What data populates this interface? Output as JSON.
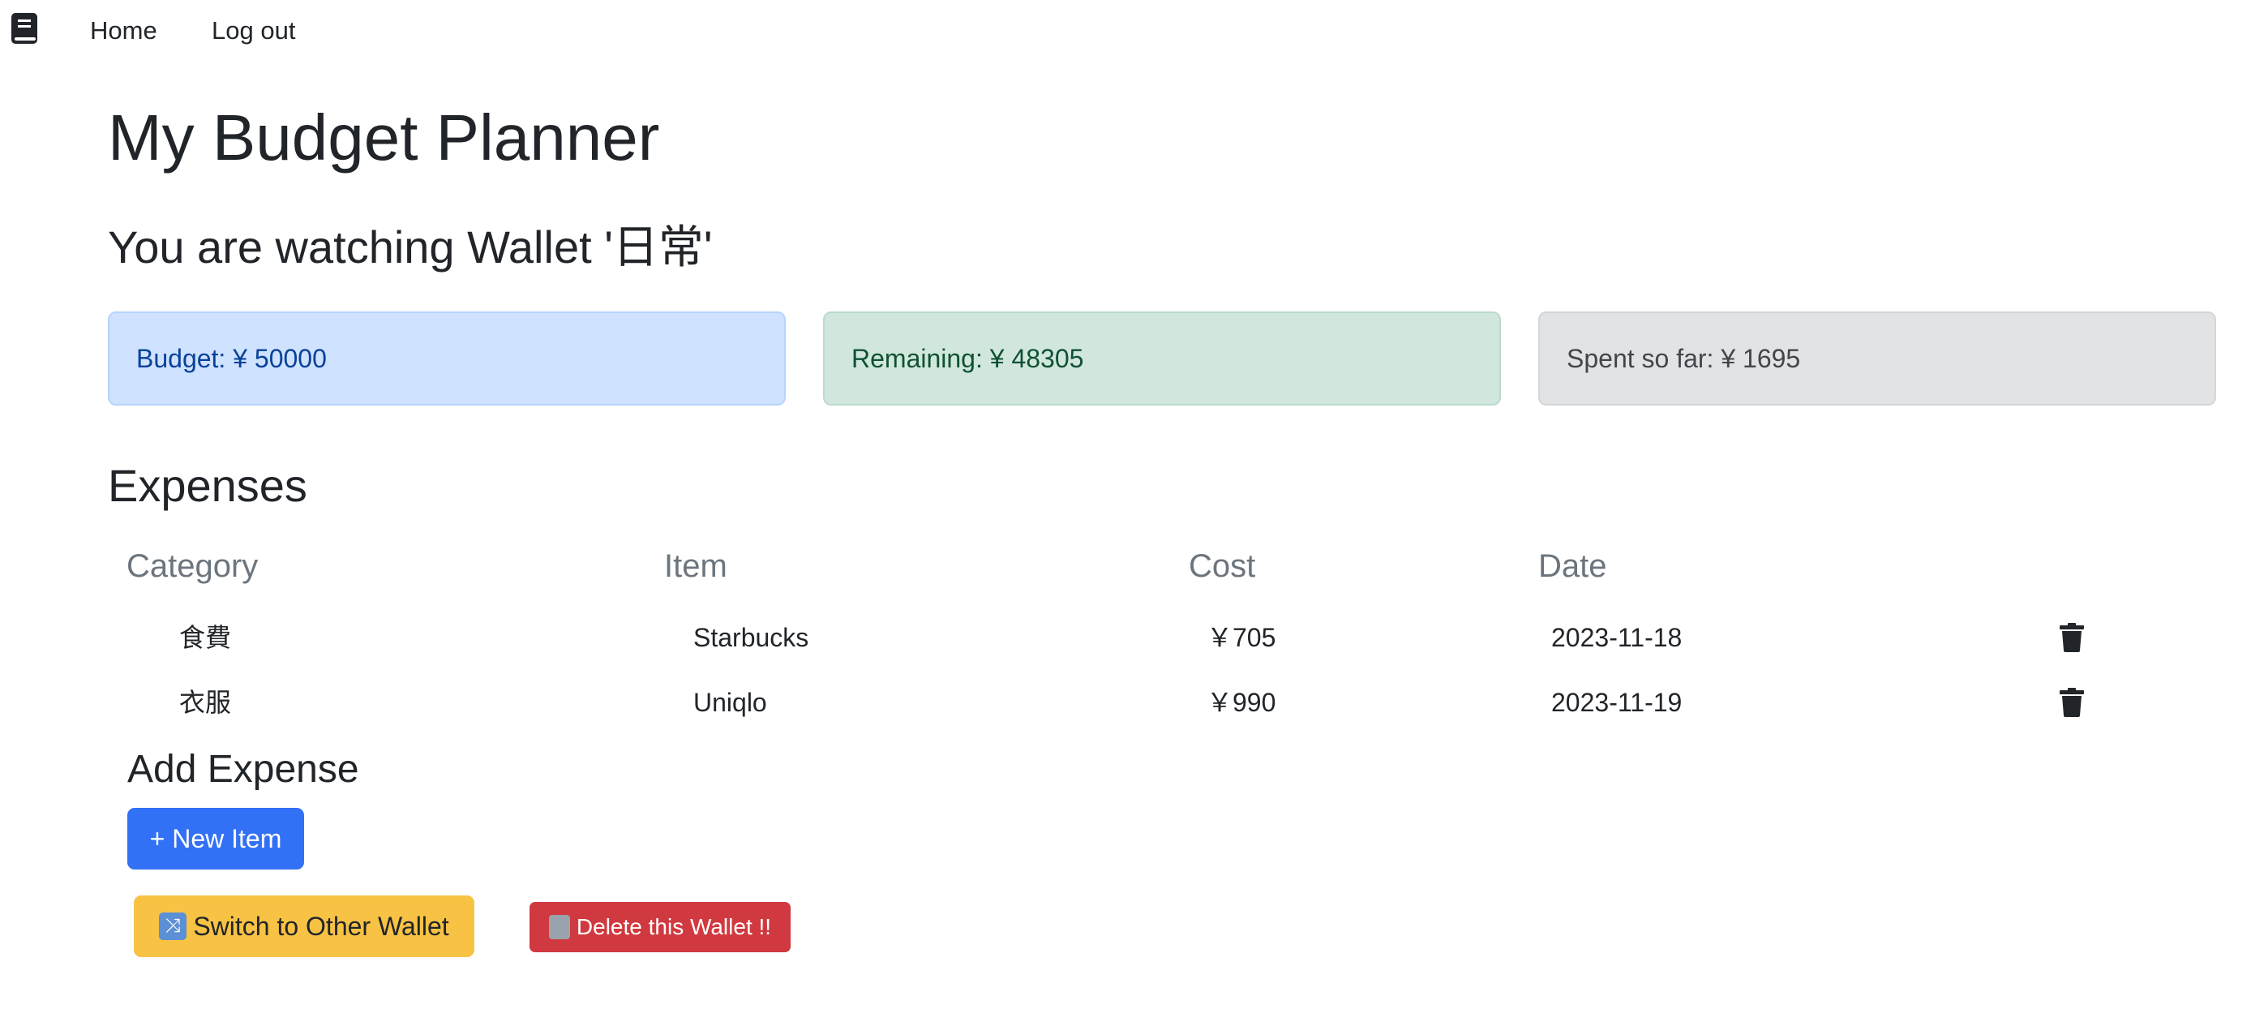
{
  "nav": {
    "logo_icon": "book-icon",
    "home_label": "Home",
    "logout_label": "Log out"
  },
  "page": {
    "title": "My Budget Planner",
    "wallet_heading": "You are watching Wallet '日常'"
  },
  "summary": {
    "budget_text": "Budget: ¥ 50000",
    "remaining_text": "Remaining: ¥ 48305",
    "spent_text": "Spent so far: ¥ 1695"
  },
  "expenses": {
    "title": "Expenses",
    "columns": [
      "Category",
      "Item",
      "Cost",
      "Date"
    ],
    "rows": [
      {
        "category": "食費",
        "item": "Starbucks",
        "cost": "￥705",
        "date": "2023-11-18"
      },
      {
        "category": "衣服",
        "item": "Uniqlo",
        "cost": "￥990",
        "date": "2023-11-19"
      }
    ],
    "delete_icon": "trash-icon"
  },
  "add_expense": {
    "title": "Add Expense",
    "new_item_label": "+ New Item"
  },
  "wallet_actions": {
    "switch_label": "Switch to Other Wallet",
    "switch_icon": "shuffle-icon",
    "delete_label": "Delete this Wallet !!",
    "delete_icon": "wastebasket-icon"
  },
  "colors": {
    "primary_button": "#3270f6",
    "warning_button": "#f8c244",
    "danger_button": "#d0393f"
  }
}
